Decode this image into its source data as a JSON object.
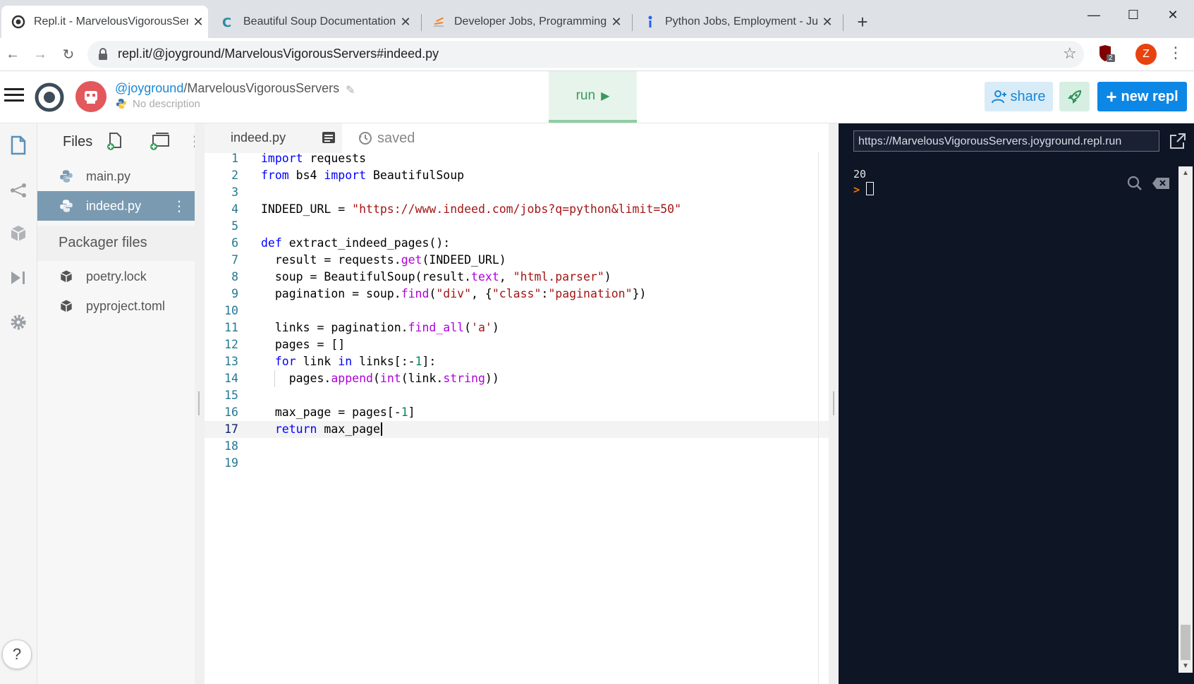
{
  "browser": {
    "tabs": [
      {
        "title": "Repl.it - MarvelousVigorousServ",
        "active": true
      },
      {
        "title": "Beautiful Soup Documentation",
        "active": false
      },
      {
        "title": "Developer Jobs, Programming J",
        "active": false
      },
      {
        "title": "Python Jobs, Employment - June",
        "active": false
      }
    ],
    "url": "repl.it/@joyground/MarvelousVigorousServers#indeed.py",
    "profile_initial": "Z",
    "extension_badge": "2"
  },
  "header": {
    "user": "@joyground",
    "separator": "/",
    "project": "MarvelousVigorousServers",
    "description": "No description",
    "run_label": "run",
    "share_label": "share",
    "new_repl_label": "new repl"
  },
  "files": {
    "title": "Files",
    "items": [
      {
        "name": "main.py"
      },
      {
        "name": "indeed.py"
      }
    ],
    "packager_title": "Packager files",
    "packager_items": [
      {
        "name": "poetry.lock"
      },
      {
        "name": "pyproject.toml"
      }
    ]
  },
  "editor": {
    "tab_name": "indeed.py",
    "status": "saved",
    "lines": [
      "1",
      "2",
      "3",
      "4",
      "5",
      "6",
      "7",
      "8",
      "9",
      "10",
      "11",
      "12",
      "13",
      "14",
      "15",
      "16",
      "17",
      "18",
      "19"
    ],
    "code": {
      "l1_kw": "import",
      "l1_rest": " requests",
      "l2_kw1": "from",
      "l2_mid": " bs4 ",
      "l2_kw2": "import",
      "l2_rest": " BeautifulSoup",
      "l4_a": "INDEED_URL = ",
      "l4_str": "\"https://www.indeed.com/jobs?q=python&limit=50\"",
      "l6_kw": "def",
      "l6_rest": " extract_indeed_pages():",
      "l7_a": "  result = requests.",
      "l7_fn": "get",
      "l7_b": "(INDEED_URL)",
      "l8_a": "  soup = BeautifulSoup(result.",
      "l8_attr": "text",
      "l8_b": ", ",
      "l8_str": "\"html.parser\"",
      "l8_c": ")",
      "l9_a": "  pagination = soup.",
      "l9_fn": "find",
      "l9_b": "(",
      "l9_s1": "\"div\"",
      "l9_c": ", {",
      "l9_s2": "\"class\"",
      "l9_d": ":",
      "l9_s3": "\"pagination\"",
      "l9_e": "})",
      "l11_a": "  links = pagination.",
      "l11_fn": "find_all",
      "l11_b": "(",
      "l11_str": "'a'",
      "l11_c": ")",
      "l12": "  pages = []",
      "l13_kw1": "  for",
      "l13_a": " link ",
      "l13_kw2": "in",
      "l13_b": " links[:-",
      "l13_num": "1",
      "l13_c": "]:",
      "l14_a": "    pages.",
      "l14_fn": "append",
      "l14_b": "(",
      "l14_fn2": "int",
      "l14_c": "(link.",
      "l14_attr": "string",
      "l14_d": "))",
      "l16_a": "  max_page = pages[-",
      "l16_num": "1",
      "l16_b": "]",
      "l17_kw": "  return",
      "l17_rest": " max_page"
    }
  },
  "console": {
    "url": "https://MarvelousVigorousServers.joyground.repl.run",
    "output": "20",
    "prompt": ">"
  }
}
